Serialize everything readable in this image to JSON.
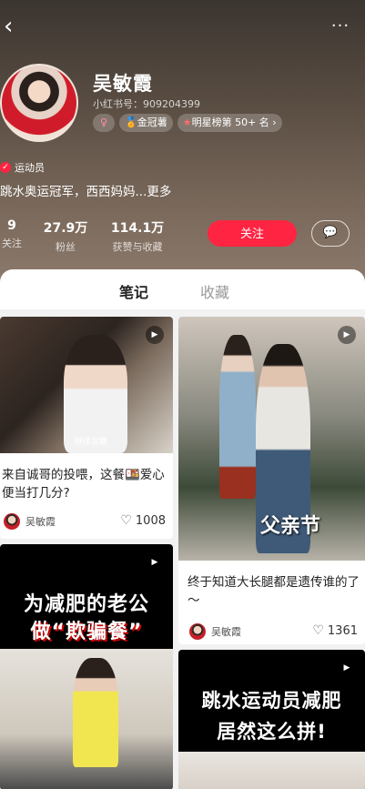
{
  "nav": {
    "back_glyph": "‹",
    "more_glyph": "···"
  },
  "profile": {
    "name": "吴敏霞",
    "red_id": "小红书号：909204399",
    "tags": {
      "gender": "♀",
      "champion": "金冠薯",
      "rank": "明星榜第 50+ 名 ›"
    },
    "occupation": "运动员",
    "bio": "跳水奥运冠军，西西妈妈...更多",
    "stats": [
      {
        "value": "9",
        "label": "关注"
      },
      {
        "value": "27.9万",
        "label": "粉丝"
      },
      {
        "value": "114.1万",
        "label": "获赞与收藏"
      }
    ],
    "follow_label": "关注",
    "message_glyph": "💬"
  },
  "tabs": [
    {
      "label": "笔记"
    },
    {
      "label": "收藏"
    }
  ],
  "notes": [
    {
      "title": "来自诚哥的投喂，这餐🍱爱心便当打几分?",
      "author": "吴敏霞",
      "likes": "1008",
      "caption": "继续发糖"
    },
    {
      "title": "终于知道大长腿都是遗传谁的了～",
      "author": "吴敏霞",
      "likes": "1361",
      "caption": "父亲节"
    },
    {
      "banner_line1": "为减肥的老公",
      "banner_line2": "做“欺骗餐”"
    },
    {
      "banner_line1": "跳水运动员减肥",
      "banner_line2": "居然这么拼!"
    }
  ],
  "colors": {
    "accent": "#ff2442"
  },
  "icons": {
    "play": "play-icon",
    "heart": "heart-icon",
    "message": "message-icon"
  }
}
